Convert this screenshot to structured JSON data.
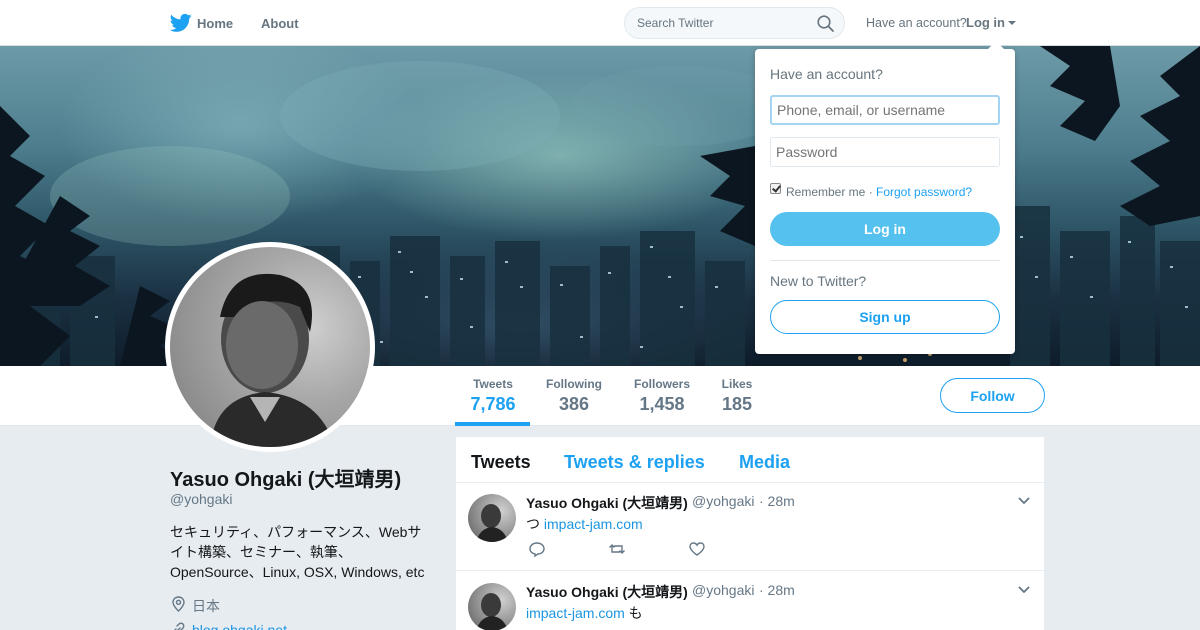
{
  "nav": {
    "home_label": "Home",
    "about_label": "About",
    "search_placeholder": "Search Twitter",
    "have_account": "Have an account?",
    "login_label": "Log in",
    "brand_color": "#1da1f2"
  },
  "profile": {
    "name": "Yasuo Ohgaki (大垣靖男)",
    "handle": "@yohgaki",
    "bio": "セキュリティ、パフォーマンス、Webサイト構築、セミナー、執筆、OpenSource、Linux, OSX, Windows, etc",
    "location": "日本",
    "website": "blog.ohgaki.net"
  },
  "stats": [
    {
      "label": "Tweets",
      "value": "7,786",
      "active": true
    },
    {
      "label": "Following",
      "value": "386"
    },
    {
      "label": "Followers",
      "value": "1,458"
    },
    {
      "label": "Likes",
      "value": "185"
    }
  ],
  "follow_label": "Follow",
  "timeline": {
    "tabs": [
      {
        "label": "Tweets",
        "active": true
      },
      {
        "label": "Tweets & replies"
      },
      {
        "label": "Media"
      }
    ],
    "tweets": [
      {
        "name": "Yasuo Ohgaki (大垣靖男)",
        "handle": "@yohgaki",
        "time": "· 28m",
        "prefix": "つ ",
        "link": "impact-jam.com",
        "suffix": ""
      },
      {
        "name": "Yasuo Ohgaki (大垣靖男)",
        "handle": "@yohgaki",
        "time": "· 28m",
        "prefix": "",
        "link": "impact-jam.com",
        "suffix": " も"
      }
    ]
  },
  "login_dropdown": {
    "title": "Have an account?",
    "username_placeholder": "Phone, email, or username",
    "password_placeholder": "Password",
    "remember_label": "Remember me",
    "separator": " · ",
    "forgot_label": "Forgot password?",
    "login_button": "Log in",
    "new_label": "New to Twitter?",
    "signup_button": "Sign up"
  },
  "icons": [
    "twitter-bird-icon",
    "search-icon",
    "caret-down-icon",
    "location-icon",
    "link-icon",
    "reply-icon",
    "retweet-icon",
    "like-icon",
    "chevron-down-icon",
    "checkbox-icon"
  ]
}
